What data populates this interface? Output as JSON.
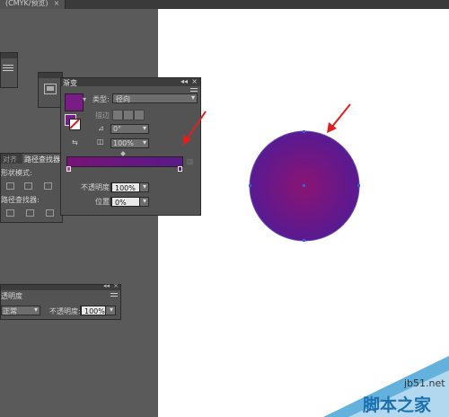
{
  "document_tab": {
    "title": "(CMYK/预览)",
    "close": "×"
  },
  "gradient_panel": {
    "title": "渐变",
    "type_label": "类型:",
    "type_value": "径向",
    "stroke_label": "描边",
    "angle_value": "0°",
    "aspect_value": "100%",
    "opacity_label": "不透明度:",
    "opacity_value": "100%",
    "location_label": "位置:",
    "location_value": "0%",
    "collapse_icon": "◂◂",
    "close_icon": "×"
  },
  "pathfinder_panel": {
    "tabs": [
      "对齐",
      "路径查找器"
    ],
    "shape_modes_label": "形状模式:",
    "pathfinders_label": "路径查找器:"
  },
  "transparency_panel": {
    "title": "透明度",
    "blend_mode": "正常",
    "opacity_label": "不透明度:",
    "opacity_value": "100%"
  },
  "watermark": {
    "site": "jb51.net",
    "name": "脚本之家"
  },
  "colors": {
    "gradient_start": "#7a127a",
    "gradient_end": "#5a1a8a",
    "circle_center": "#8a1474",
    "circle_edge": "#581a92",
    "arrow": "#e02020",
    "swatch": "#7b2d88"
  }
}
